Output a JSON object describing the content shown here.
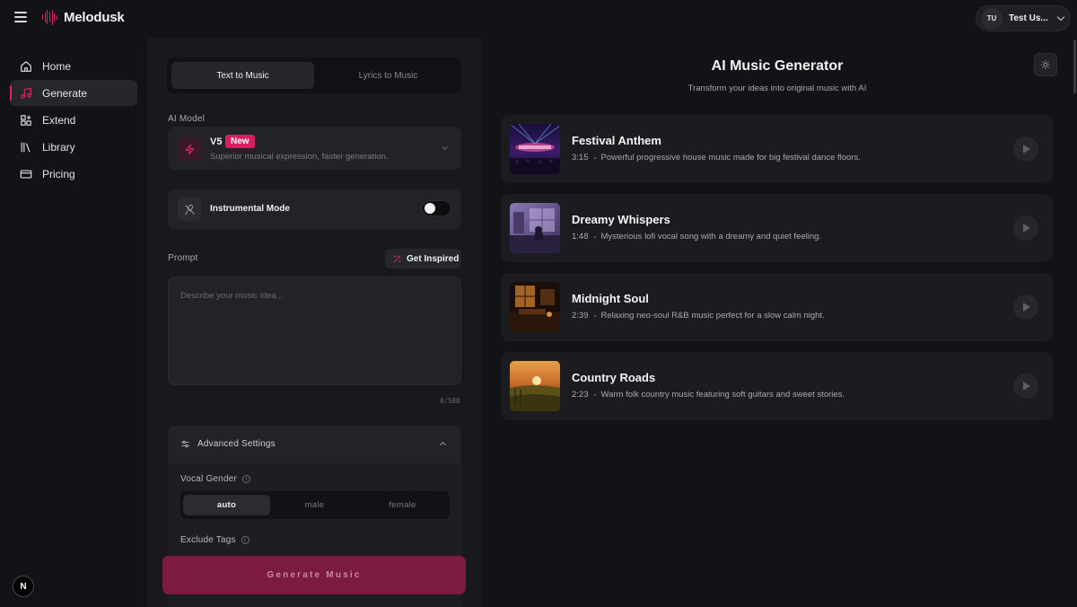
{
  "app": {
    "name": "Melodusk"
  },
  "user": {
    "initials": "TU",
    "name": "Test Us..."
  },
  "sidebar": {
    "items": [
      {
        "label": "Home",
        "icon": "home-icon"
      },
      {
        "label": "Generate",
        "icon": "music-note-icon",
        "active": true
      },
      {
        "label": "Extend",
        "icon": "extend-icon"
      },
      {
        "label": "Library",
        "icon": "library-icon"
      },
      {
        "label": "Pricing",
        "icon": "credit-card-icon"
      }
    ],
    "bottom_badge": "N"
  },
  "panel": {
    "tabs": [
      {
        "label": "Text to Music",
        "active": true
      },
      {
        "label": "Lyrics to Music",
        "active": false
      }
    ],
    "ai_model_label": "AI Model",
    "model": {
      "name": "V5",
      "badge": "New",
      "description": "Superior musical expression, faster generation."
    },
    "instrumental": {
      "label": "Instrumental Mode",
      "enabled": false
    },
    "prompt": {
      "label": "Prompt",
      "inspire_label": "Get Inspired",
      "placeholder": "Describe your music idea...",
      "value": "",
      "counter": "0/500"
    },
    "advanced": {
      "title": "Advanced Settings",
      "vocal_gender_label": "Vocal Gender",
      "vocal_options": [
        "auto",
        "male",
        "female"
      ],
      "vocal_selected": "auto",
      "exclude_tags_label": "Exclude Tags"
    },
    "generate_label": "Generate Music"
  },
  "main": {
    "title": "AI Music Generator",
    "subtitle": "Transform your ideas into original music with AI",
    "tracks": [
      {
        "title": "Festival Anthem",
        "duration": "3:15",
        "description": "Powerful progressive house music made for big festival dance floors."
      },
      {
        "title": "Dreamy Whispers",
        "duration": "1:48",
        "description": "Mysterious lofi vocal song with a dreamy and quiet feeling."
      },
      {
        "title": "Midnight Soul",
        "duration": "2:39",
        "description": "Relaxing neo-soul R&B music perfect for a slow calm night."
      },
      {
        "title": "Country Roads",
        "duration": "2:23",
        "description": "Warm folk country music featuring soft guitars and sweet stories."
      }
    ]
  },
  "colors": {
    "accent": "#e0245e",
    "background": "#121316",
    "panel": "#18191c",
    "card": "#222328"
  }
}
